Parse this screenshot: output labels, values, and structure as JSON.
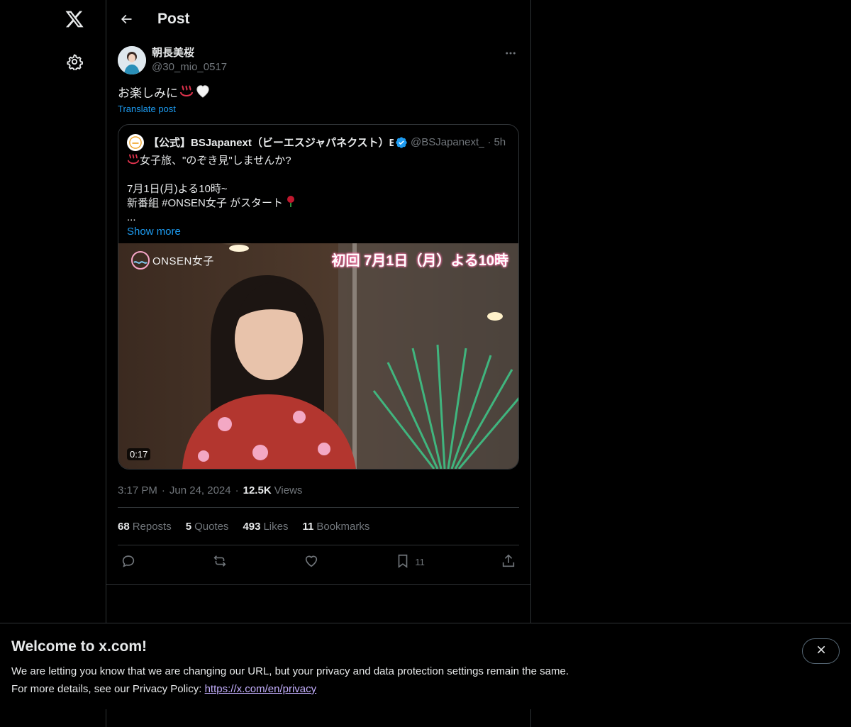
{
  "header": {
    "title": "Post"
  },
  "post": {
    "author_name": "朝長美桜",
    "author_handle": "@30_mio_0517",
    "text": "お楽しみに♨️🤍",
    "text_main": "お楽しみに",
    "translate_label": "Translate post",
    "timestamp": "3:17 PM",
    "date": "Jun 24, 2024",
    "views_count": "12.5K",
    "views_label": "Views"
  },
  "quote": {
    "name": "【公式】BSJapanext（ビーエスジャパネクスト）B",
    "handle": "@BSJapanext_",
    "time": "5h",
    "line1": "女子旅、\"のぞき見\"しませんか?",
    "line2": "",
    "line3": "7月1日(月)よる10時~",
    "line4": "新番組 #ONSEN女子 がスタート",
    "line5": "...",
    "show_more": "Show more",
    "video_logo": "ONSEN女子",
    "video_caption": "初回 7月1日（月）よる10時",
    "video_duration": "0:17"
  },
  "stats": {
    "reposts_count": "68",
    "reposts_label": "Reposts",
    "quotes_count": "5",
    "quotes_label": "Quotes",
    "likes_count": "493",
    "likes_label": "Likes",
    "bookmarks_count": "11",
    "bookmarks_label": "Bookmarks"
  },
  "actions": {
    "bookmark_count": "11"
  },
  "banner": {
    "title": "Welcome to x.com!",
    "line1": "We are letting you know that we are changing our URL, but your privacy and data protection settings remain the same.",
    "line2_prefix": "For more details, see our Privacy Policy: ",
    "link": "https://x.com/en/privacy"
  },
  "icons": {
    "logo": "x-logo-icon",
    "settings": "gear-icon",
    "back": "arrow-left-icon",
    "more": "more-horizontal-icon",
    "verified": "verified-badge-icon",
    "reply": "reply-icon",
    "repost": "repost-icon",
    "like": "heart-icon",
    "bookmark": "bookmark-icon",
    "share": "share-icon",
    "close": "close-icon"
  },
  "colors": {
    "accent": "#1d9bf0",
    "background": "#000000",
    "muted": "#71767b",
    "text": "#e7e9ea",
    "border": "#2f3336"
  }
}
